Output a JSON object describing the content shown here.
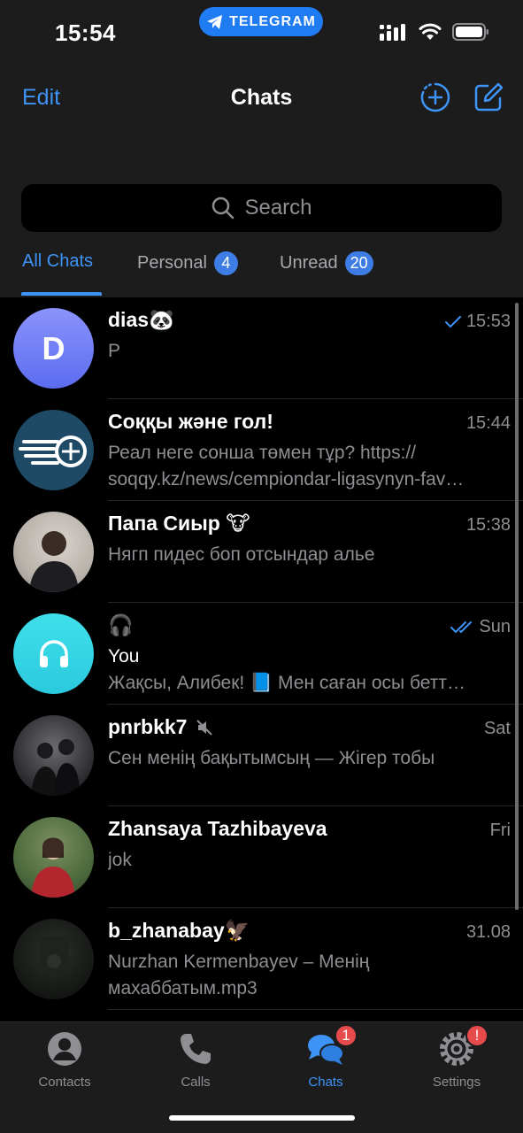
{
  "status_bar": {
    "time": "15:54",
    "app_pill": "TELEGRAM"
  },
  "nav": {
    "edit_label": "Edit",
    "title": "Chats"
  },
  "search": {
    "placeholder": "Search"
  },
  "folders": [
    {
      "label": "All Chats",
      "badge": ""
    },
    {
      "label": "Personal",
      "badge": "4"
    },
    {
      "label": "Unread",
      "badge": "20"
    }
  ],
  "chats": [
    {
      "name": "dias🐼",
      "time": "15:53",
      "read_status": "single-check",
      "sender": "",
      "message": "P",
      "avatar_letter": "D",
      "avatar_color": "#6d7cf5"
    },
    {
      "name": "Соққы және гол!",
      "time": "15:44",
      "read_status": "",
      "sender": "",
      "message": "Реал неге сонша төмен тұр? https:// soqqy.kz/news/cempiondar-ligasynyn-fav…",
      "avatar_letter": "",
      "avatar_color": "#1f4a66"
    },
    {
      "name": "Папа Сиыр 🐮",
      "time": "15:38",
      "read_status": "",
      "sender": "",
      "message": "Нягп пидес боп отсындар алье",
      "avatar_letter": "",
      "avatar_color": "#cfc9c4"
    },
    {
      "name": "🎧",
      "time": "Sun",
      "read_status": "double-check",
      "sender": "You",
      "message": "Жақсы, Алибек! 📘 Мен саған осы бетт…",
      "avatar_letter": "",
      "avatar_color": "#35d6e5"
    },
    {
      "name": "pnrbkk7",
      "time": "Sat",
      "read_status": "",
      "sender": "",
      "message": "Сен менің бақытымсың — Жігер тобы",
      "avatar_letter": "",
      "avatar_color": "#3a3a3f",
      "muted": true
    },
    {
      "name": "Zhansaya Tazhibayeva",
      "time": "Fri",
      "read_status": "",
      "sender": "",
      "message": "jok",
      "avatar_letter": "",
      "avatar_color": "#4e6b3e"
    },
    {
      "name": "b_zhanabay🦅",
      "time": "31.08",
      "read_status": "",
      "sender": "",
      "message": "Nurzhan Kermenbayev – Менің махаббатым.mp3",
      "avatar_letter": "",
      "avatar_color": "#1a1d1a"
    }
  ],
  "tab_bar": {
    "items": [
      {
        "label": "Contacts",
        "icon": "person-circle-icon",
        "badge": ""
      },
      {
        "label": "Calls",
        "icon": "phone-icon",
        "badge": ""
      },
      {
        "label": "Chats",
        "icon": "chat-bubbles-icon",
        "badge": "1"
      },
      {
        "label": "Settings",
        "icon": "gear-icon",
        "badge": "!"
      }
    ]
  },
  "colors": {
    "accent": "#3e93f7",
    "background": "#000000",
    "header": "#1c1c1d",
    "secondary_text": "#8e8e93",
    "badge_red": "#e64a4a"
  }
}
